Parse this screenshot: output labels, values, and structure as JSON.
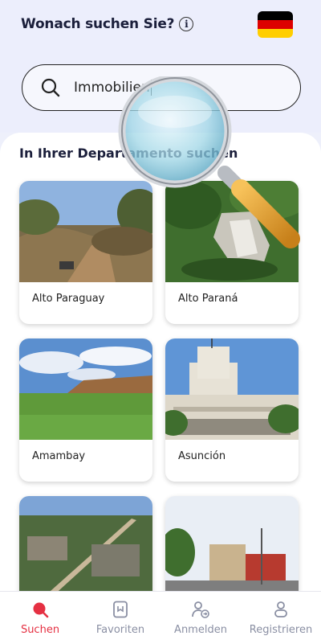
{
  "header": {
    "question": "Wonach suchen Sie?",
    "info_icon": "info-icon",
    "flag": {
      "icon": "germany-flag-icon",
      "colors": [
        "#000000",
        "#dd0000",
        "#ffce00"
      ]
    }
  },
  "search": {
    "value": "Immobilien",
    "icon": "search-icon"
  },
  "section": {
    "title": "In Ihrer Departamento suchen"
  },
  "departments": [
    {
      "name": "Alto Paraguay"
    },
    {
      "name": "Alto Paraná"
    },
    {
      "name": "Amambay"
    },
    {
      "name": "Asunción"
    },
    {
      "name": ""
    },
    {
      "name": ""
    }
  ],
  "nav": {
    "items": [
      {
        "label": "Suchen",
        "icon": "search-icon",
        "active": true
      },
      {
        "label": "Favoriten",
        "icon": "bookmark-icon",
        "active": false
      },
      {
        "label": "Anmelden",
        "icon": "login-user-icon",
        "active": false
      },
      {
        "label": "Registrieren",
        "icon": "user-icon",
        "active": false
      }
    ]
  },
  "colors": {
    "accent": "#e53042",
    "background": "#eef0fb",
    "text": "#1b1f3b",
    "inactive": "#8a8fa3"
  }
}
